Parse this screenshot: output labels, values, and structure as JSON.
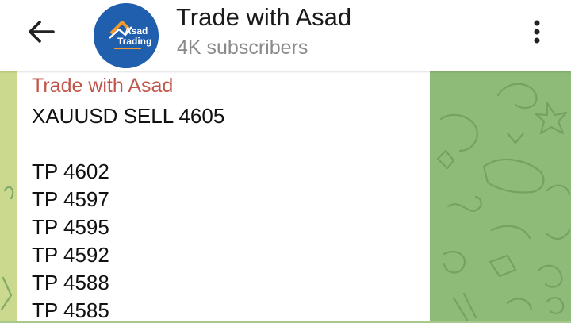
{
  "header": {
    "title": "Trade with Asad",
    "subtitle": "4K subscribers",
    "back_icon": "arrow-left-icon",
    "menu_icon": "more-vertical-icon",
    "avatar": {
      "brand_line1": "Asad",
      "brand_line2": "Trading",
      "background": "#1f5fae"
    }
  },
  "message": {
    "sender": "Trade with Asad",
    "sender_color": "#c0564b",
    "headline": "XAUUSD SELL 4605",
    "targets": [
      "TP 4602",
      "TP 4597",
      "TP 4595",
      "TP 4592",
      "TP 4588",
      "TP 4585"
    ]
  },
  "colors": {
    "chat_background": "#8fbb79",
    "left_strip": "#cbd98f"
  }
}
